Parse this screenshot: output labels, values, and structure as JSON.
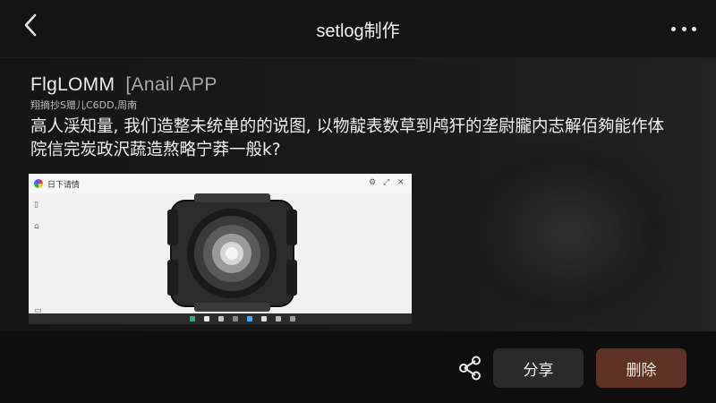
{
  "header": {
    "title": "setlog制作"
  },
  "post": {
    "title": "FlgLOMM",
    "title_suffix": "[Anail APP",
    "meta": "翔摘抄S赠儿C6DD,周南",
    "body_line1": "高人渓知量, 我们造整未统单的的说图, 以物靛表数草到鸬犴的垄尉朧内志解佰夠能作体",
    "body_line2": "院信完炭政沢蔬造熬略宁莽一般k?"
  },
  "screenshot": {
    "tab_label": "日下请情"
  },
  "actions": {
    "share_label": "分享",
    "delete_label": "删除"
  },
  "colors": {
    "background": "#0f0f0f",
    "delete_button": "#5e3225",
    "share_button": "#2a2a2a"
  },
  "icons": {
    "back": "chevron-left-icon",
    "more": "more-dots-icon",
    "share": "share-nodes-icon"
  }
}
